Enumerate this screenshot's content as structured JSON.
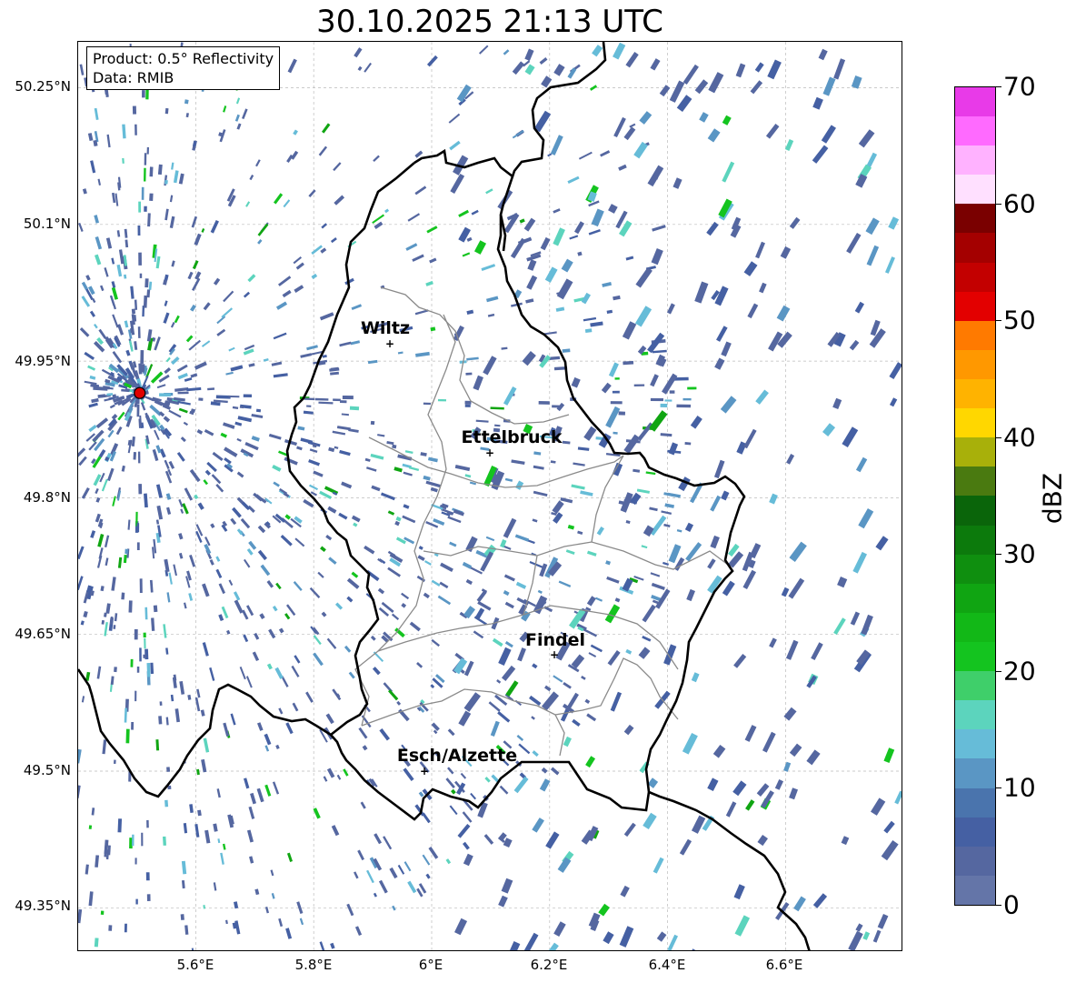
{
  "title": "30.10.2025 21:13 UTC",
  "info": {
    "product": "Product: 0.5° Reflectivity",
    "data": "Data: RMIB"
  },
  "axes": {
    "lat_ticks": [
      "49.35°N",
      "49.5°N",
      "49.65°N",
      "49.8°N",
      "49.95°N",
      "50.1°N",
      "50.25°N"
    ],
    "lon_ticks": [
      "5.6°E",
      "5.8°E",
      "6°E",
      "6.2°E",
      "6.4°E",
      "6.6°E"
    ]
  },
  "cities": [
    {
      "name": "Wiltz"
    },
    {
      "name": "Ettelbruck"
    },
    {
      "name": "Findel"
    },
    {
      "name": "Esch/Alzette"
    }
  ],
  "colorbar": {
    "unit": "dBZ",
    "tick_labels": [
      "0",
      "10",
      "20",
      "30",
      "40",
      "50",
      "60",
      "70"
    ],
    "min": 0,
    "max": 70,
    "step": 2.5,
    "colors": [
      "#6475a8",
      "#5567a0",
      "#4560a3",
      "#4a74ad",
      "#5a96c4",
      "#66bcd8",
      "#5cd4bd",
      "#3fcf6a",
      "#14c41f",
      "#12b817",
      "#10a512",
      "#0f8f0f",
      "#0c7a0c",
      "#0a650a",
      "#4a7a10",
      "#a8b00a",
      "#ffd700",
      "#ffb300",
      "#ff9800",
      "#ff7a00",
      "#e30000",
      "#c30000",
      "#a40000",
      "#7a0000",
      "#ffe0ff",
      "#ffb2ff",
      "#ff6aff",
      "#e83ae8"
    ]
  },
  "map_style": {
    "border_color": "#000000",
    "canton_color": "#8a8a8a",
    "grid_color": "#bbbbbb",
    "radar_site_color": "#e00000"
  },
  "radar_site": {
    "lon": 5.505,
    "lat": 49.915
  }
}
